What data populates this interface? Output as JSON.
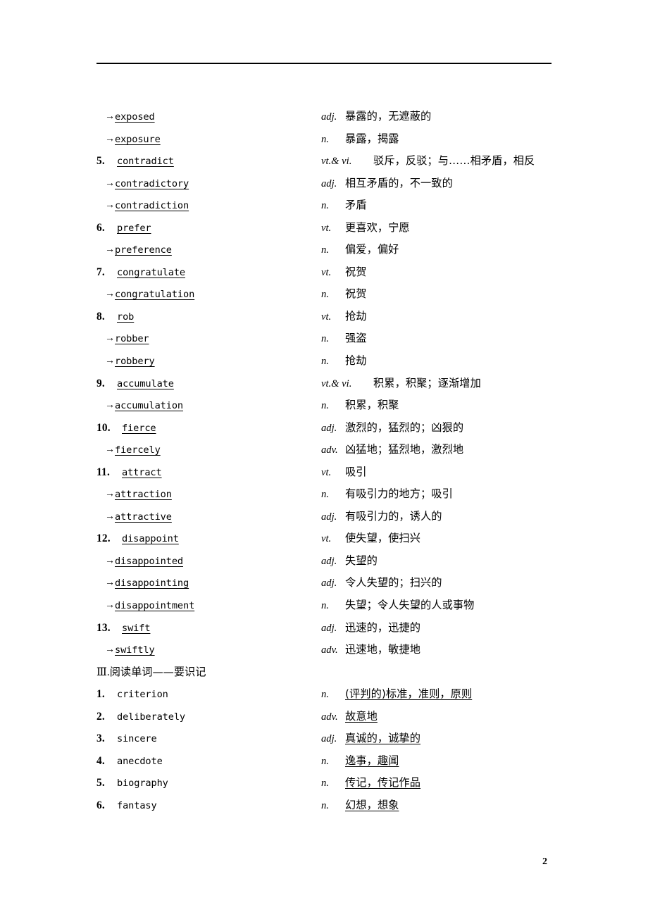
{
  "page": {
    "number": "2",
    "header_rule": true
  },
  "entries": [
    {
      "marker": "arrow",
      "num": "",
      "word": "exposed",
      "word_underline": true,
      "pos": "adj.",
      "pos_wide": false,
      "meaning": "暴露的，无遮蔽的",
      "meaning_underline": false
    },
    {
      "marker": "arrow",
      "num": "",
      "word": "exposure",
      "word_underline": true,
      "pos": "n.",
      "pos_wide": false,
      "meaning": "暴露，揭露",
      "meaning_underline": false
    },
    {
      "marker": "num",
      "num": "5.",
      "word": "contradict",
      "word_underline": true,
      "pos": "vt.& vi.",
      "pos_wide": true,
      "meaning": "驳斥，反驳；与……相矛盾，相反",
      "meaning_underline": false
    },
    {
      "marker": "arrow",
      "num": "",
      "word": "contradictory",
      "word_underline": true,
      "pos": "adj.",
      "pos_wide": false,
      "meaning": "相互矛盾的，不一致的",
      "meaning_underline": false
    },
    {
      "marker": "arrow",
      "num": "",
      "word": "contradiction",
      "word_underline": true,
      "pos": "n.",
      "pos_wide": false,
      "meaning": "矛盾",
      "meaning_underline": false
    },
    {
      "marker": "num",
      "num": "6.",
      "word": "prefer",
      "word_underline": true,
      "pos": "vt.",
      "pos_wide": false,
      "meaning": "更喜欢，宁愿",
      "meaning_underline": false
    },
    {
      "marker": "arrow",
      "num": "",
      "word": "preference",
      "word_underline": true,
      "pos": "n.",
      "pos_wide": false,
      "meaning": "偏爱，偏好",
      "meaning_underline": false
    },
    {
      "marker": "num",
      "num": "7.",
      "word": "congratulate",
      "word_underline": true,
      "pos": "vt.",
      "pos_wide": false,
      "meaning": "祝贺",
      "meaning_underline": false
    },
    {
      "marker": "arrow",
      "num": "",
      "word": "congratulation",
      "word_underline": true,
      "pos": "n.",
      "pos_wide": false,
      "meaning": "祝贺",
      "meaning_underline": false
    },
    {
      "marker": "num",
      "num": "8.",
      "word": "rob",
      "word_underline": true,
      "pos": "vt.",
      "pos_wide": false,
      "meaning": "抢劫",
      "meaning_underline": false
    },
    {
      "marker": "arrow",
      "num": "",
      "word": "robber",
      "word_underline": true,
      "pos": "n.",
      "pos_wide": false,
      "meaning": "强盗",
      "meaning_underline": false
    },
    {
      "marker": "arrow",
      "num": "",
      "word": "robbery",
      "word_underline": true,
      "pos": "n.",
      "pos_wide": false,
      "meaning": "抢劫",
      "meaning_underline": false
    },
    {
      "marker": "num",
      "num": "9.",
      "word": "accumulate",
      "word_underline": true,
      "pos": "vt.& vi.",
      "pos_wide": true,
      "meaning": "积累，积聚；逐渐增加",
      "meaning_underline": false
    },
    {
      "marker": "arrow",
      "num": "",
      "word": "accumulation",
      "word_underline": true,
      "pos": "n.",
      "pos_wide": false,
      "meaning": "积累，积聚",
      "meaning_underline": false
    },
    {
      "marker": "num2",
      "num": "10.",
      "word": "fierce",
      "word_underline": true,
      "pos": "adj.",
      "pos_wide": false,
      "meaning": "激烈的，猛烈的；凶狠的",
      "meaning_underline": false
    },
    {
      "marker": "arrow",
      "num": "",
      "word": "fiercely",
      "word_underline": true,
      "pos": "adv.",
      "pos_wide": false,
      "meaning": "凶猛地；猛烈地，激烈地",
      "meaning_underline": false
    },
    {
      "marker": "num2",
      "num": "11.",
      "word": "attract",
      "word_underline": true,
      "pos": "vt.",
      "pos_wide": false,
      "meaning": "吸引",
      "meaning_underline": false
    },
    {
      "marker": "arrow",
      "num": "",
      "word": "attraction",
      "word_underline": true,
      "pos": "n.",
      "pos_wide": false,
      "meaning": "有吸引力的地方；吸引",
      "meaning_underline": false
    },
    {
      "marker": "arrow",
      "num": "",
      "word": "attractive",
      "word_underline": true,
      "pos": "adj.",
      "pos_wide": false,
      "meaning": "有吸引力的，诱人的",
      "meaning_underline": false
    },
    {
      "marker": "num2",
      "num": "12.",
      "word": "disappoint",
      "word_underline": true,
      "pos": "vt.",
      "pos_wide": false,
      "meaning": "使失望，使扫兴",
      "meaning_underline": false
    },
    {
      "marker": "arrow",
      "num": "",
      "word": "disappointed",
      "word_underline": true,
      "pos": "adj.",
      "pos_wide": false,
      "meaning": "失望的",
      "meaning_underline": false
    },
    {
      "marker": "arrow",
      "num": "",
      "word": "disappointing",
      "word_underline": true,
      "pos": "adj.",
      "pos_wide": false,
      "meaning": "令人失望的；扫兴的",
      "meaning_underline": false
    },
    {
      "marker": "arrow",
      "num": "",
      "word": "disappointment",
      "word_underline": true,
      "pos": "n.",
      "pos_wide": false,
      "meaning": "失望；令人失望的人或事物",
      "meaning_underline": false
    },
    {
      "marker": "num2",
      "num": "13.",
      "word": "swift",
      "word_underline": true,
      "pos": "adj.",
      "pos_wide": false,
      "meaning": "迅速的，迅捷的",
      "meaning_underline": false
    },
    {
      "marker": "arrow",
      "num": "",
      "word": "swiftly",
      "word_underline": true,
      "pos": "adv.",
      "pos_wide": false,
      "meaning": "迅速地，敏捷地",
      "meaning_underline": false
    }
  ],
  "section3": {
    "roman": "Ⅲ.",
    "title": "阅读单词——要识记",
    "entries": [
      {
        "marker": "num",
        "num": "1.",
        "word": "criterion",
        "word_underline": false,
        "pos": "n.",
        "pos_wide": false,
        "meaning": "(评判的)标准，准则，原则",
        "meaning_underline": true
      },
      {
        "marker": "num",
        "num": "2.",
        "word": "deliberately",
        "word_underline": false,
        "pos": "adv.",
        "pos_wide": false,
        "meaning": "故意地",
        "meaning_underline": true
      },
      {
        "marker": "num",
        "num": "3.",
        "word": "sincere",
        "word_underline": false,
        "pos": "adj.",
        "pos_wide": false,
        "meaning": "真诚的，诚挚的",
        "meaning_underline": true
      },
      {
        "marker": "num",
        "num": "4.",
        "word": "anecdote",
        "word_underline": false,
        "pos": "n.",
        "pos_wide": false,
        "meaning": "逸事，趣闻",
        "meaning_underline": true
      },
      {
        "marker": "num",
        "num": "5.",
        "word": "biography",
        "word_underline": false,
        "pos": "n.",
        "pos_wide": false,
        "meaning": "传记，传记作品",
        "meaning_underline": true
      },
      {
        "marker": "num",
        "num": "6.",
        "word": "fantasy",
        "word_underline": false,
        "pos": "n.",
        "pos_wide": false,
        "meaning": "幻想，想象",
        "meaning_underline": true
      }
    ]
  },
  "icons": {
    "derivation_arrow": "→"
  }
}
